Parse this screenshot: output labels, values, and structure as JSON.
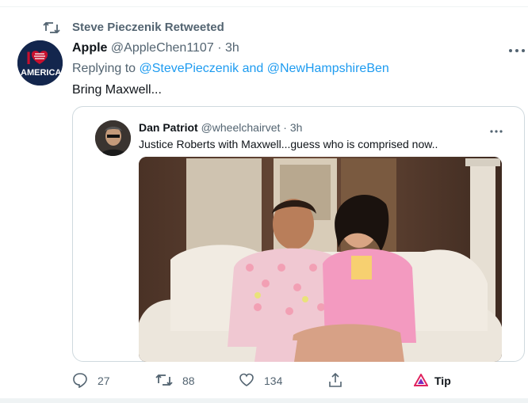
{
  "retweet": {
    "label": "Steve Pieczenik Retweeted",
    "icon": "retweet-icon"
  },
  "tweet": {
    "name": "Apple",
    "handle": "@AppleChen1107",
    "separator": "·",
    "time": "3h",
    "avatar_text": "I AMERICA",
    "reply_prefix": "Replying to",
    "reply_to": "@StevePieczenik and @NewHampshireBen",
    "text": "Bring Maxwell..."
  },
  "quote": {
    "name": "Dan Patriot",
    "handle": "@wheelchairvet",
    "separator": "·",
    "time": "3h",
    "text": "Justice Roberts with Maxwell...guess who is comprised now.."
  },
  "actions": {
    "reply_count": "27",
    "retweet_count": "88",
    "like_count": "134",
    "tip_label": "Tip"
  },
  "colors": {
    "link": "#1d9bf0",
    "muted": "#536471",
    "text": "#0f1419",
    "border": "#cfd9de"
  }
}
